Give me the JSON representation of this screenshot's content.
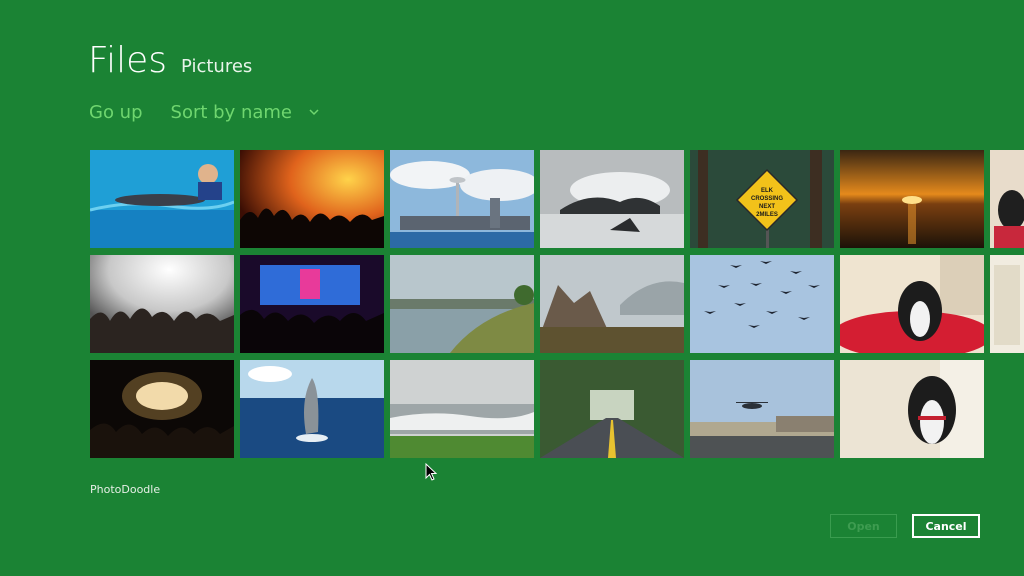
{
  "header": {
    "title": "Files",
    "location": "Pictures"
  },
  "commands": {
    "go_up": "Go up",
    "sort": "Sort by name"
  },
  "thumbnails": [
    {
      "name": "swimmer-dolphin"
    },
    {
      "name": "concert-orange"
    },
    {
      "name": "seattle-skyline"
    },
    {
      "name": "waves-rocks"
    },
    {
      "name": "elk-crossing-sign",
      "sign_text": [
        "ELK",
        "CROSSING",
        "NEXT",
        "2MILES"
      ]
    },
    {
      "name": "sunset-ocean"
    },
    {
      "name": "concert-crowd-white"
    },
    {
      "name": "concert-stage-blue"
    },
    {
      "name": "coastal-bay"
    },
    {
      "name": "sea-rocks-cliff"
    },
    {
      "name": "birds-sky"
    },
    {
      "name": "dog-red-bed"
    },
    {
      "name": "concert-spotlight"
    },
    {
      "name": "dolphin-jump"
    },
    {
      "name": "beach-surf"
    },
    {
      "name": "forest-road"
    },
    {
      "name": "helicopter-harbor"
    },
    {
      "name": "dog-portrait"
    }
  ],
  "folder_label": "PhotoDoodle",
  "buttons": {
    "open": "Open",
    "cancel": "Cancel"
  },
  "colors": {
    "background": "#1b8334",
    "accent": "#6fd66f"
  }
}
